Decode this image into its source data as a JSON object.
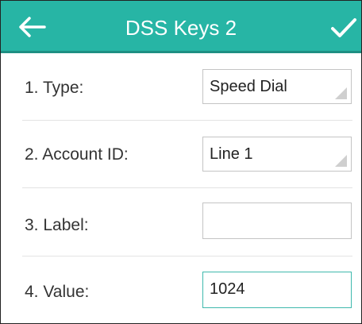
{
  "header": {
    "title": "DSS Keys 2",
    "back_icon": "arrow-left-icon",
    "confirm_icon": "checkmark-icon",
    "color": "#27b5a5"
  },
  "fields": [
    {
      "label": "1. Type:",
      "value": "Speed Dial",
      "kind": "select"
    },
    {
      "label": "2. Account ID:",
      "value": "Line 1",
      "kind": "select"
    },
    {
      "label": "3. Label:",
      "value": "",
      "kind": "text"
    },
    {
      "label": "4. Value:",
      "value": "1024",
      "kind": "text",
      "focused": true
    }
  ]
}
